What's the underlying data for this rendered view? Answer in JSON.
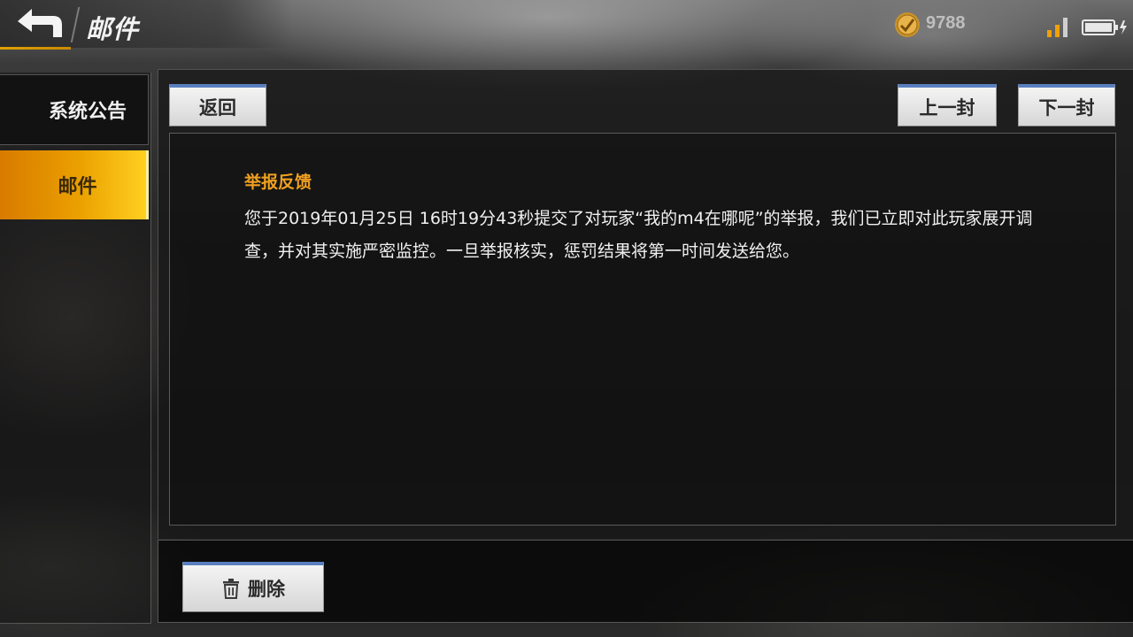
{
  "header": {
    "title": "邮件",
    "currency_amount": "9788"
  },
  "nav": {
    "items": [
      {
        "label": "系统公告",
        "active": false
      },
      {
        "label": "邮件",
        "active": true
      }
    ]
  },
  "toolbar": {
    "back_label": "返回",
    "prev_label": "上一封",
    "next_label": "下一封"
  },
  "mail": {
    "subject": "举报反馈",
    "body": "您于2019年01月25日 16时19分43秒提交了对玩家“我的m4在哪呢”的举报，我们已立即对此玩家展开调查，并对其实施严密监控。一旦举报核实，惩罚结果将第一时间发送给您。"
  },
  "footer": {
    "delete_label": "删除"
  },
  "colors": {
    "accent": "#eba100",
    "subject": "#f0a020",
    "button_top": "#5a7fc0"
  },
  "icons": {
    "back": "back-arrow-icon",
    "currency": "coin-icon",
    "signal": "signal-icon",
    "battery": "battery-charging-icon",
    "delete": "trash-icon"
  }
}
